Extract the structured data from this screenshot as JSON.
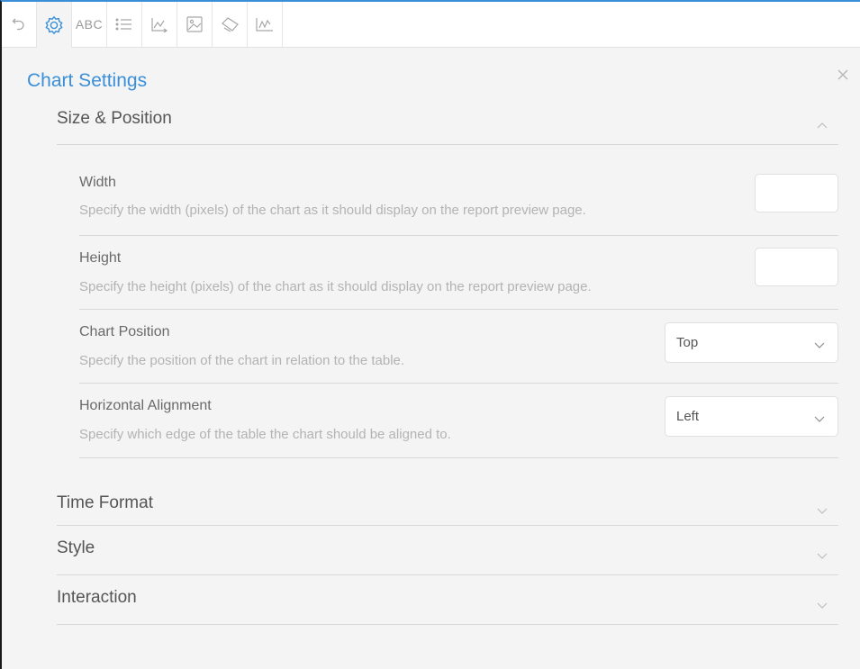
{
  "toolbar": {
    "tools": [
      {
        "icon": "undo-icon"
      },
      {
        "icon": "gear-icon"
      },
      {
        "icon": "text-abc-icon",
        "label": "ABC"
      },
      {
        "icon": "list-icon"
      },
      {
        "icon": "axis-chart-icon"
      },
      {
        "icon": "image-icon"
      },
      {
        "icon": "tag-icon"
      },
      {
        "icon": "line-chart-icon"
      }
    ],
    "active_index": 1
  },
  "panel": {
    "title": "Chart Settings"
  },
  "sections": [
    {
      "label": "Size & Position",
      "expanded": true,
      "settings": [
        {
          "name": "Width",
          "description": "Specify the width (pixels) of the chart as it should display on the report preview page.",
          "control": "number",
          "value": ""
        },
        {
          "name": "Height",
          "description": "Specify the height (pixels) of the chart as it should display on the report preview page.",
          "control": "number",
          "value": ""
        },
        {
          "name": "Chart Position",
          "description": "Specify the position of the chart in relation to the table.",
          "control": "select",
          "value": "Top"
        },
        {
          "name": "Horizontal Alignment",
          "description": "Specify which edge of the table the chart should be aligned to.",
          "control": "select",
          "value": "Left"
        }
      ]
    },
    {
      "label": "Time Format",
      "expanded": false
    },
    {
      "label": "Style",
      "expanded": false
    },
    {
      "label": "Interaction",
      "expanded": false
    }
  ],
  "colors": {
    "accent": "#3a8fd8",
    "panel_bg": "#f4f4f4",
    "divider": "#d8d8d8"
  }
}
